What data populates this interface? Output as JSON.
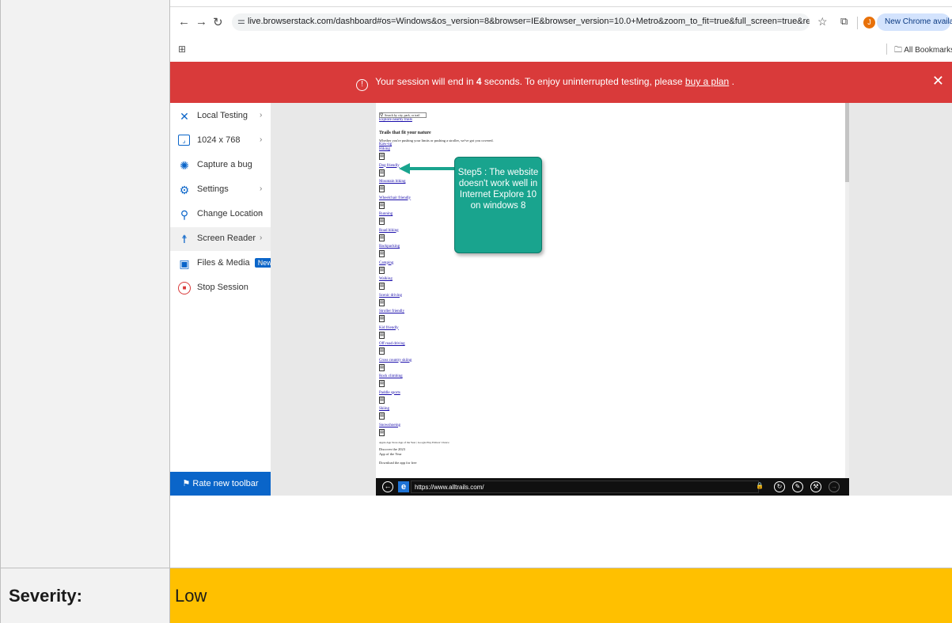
{
  "browser": {
    "url": "live.browserstack.com/dashboard#os=Windows&os_version=8&browser=IE&browser_version=10.0+Metro&zoom_to_fit=true&full_screen=true&resolution=2048x1536&...",
    "profile_initial": "J",
    "update_label": "New Chrome available",
    "all_bookmarks": "All Bookmarks"
  },
  "banner": {
    "text_before": "Your session will end in",
    "seconds": "4",
    "text_middle": "seconds. To enjoy uninterrupted testing, please",
    "link": "buy a plan",
    "text_after": "."
  },
  "sidebar": {
    "items": [
      {
        "label": "Local Testing",
        "icon": "local-testing-icon",
        "glyph": "✕",
        "chevron": true
      },
      {
        "label": "1024 x 768",
        "icon": "resolution-icon",
        "glyph": "⌜",
        "chevron": true
      },
      {
        "label": "Capture a bug",
        "icon": "bug-icon",
        "glyph": "✺",
        "chevron": false
      },
      {
        "label": "Settings",
        "icon": "gear-icon",
        "glyph": "⚙",
        "chevron": true
      },
      {
        "label": "Change Location",
        "icon": "location-pin-icon",
        "glyph": "⚲",
        "chevron": true
      },
      {
        "label": "Screen Reader",
        "icon": "accessibility-icon",
        "glyph": "☨",
        "chevron": true
      },
      {
        "label": "Files & Media",
        "icon": "media-icon",
        "glyph": "▣",
        "chevron": true,
        "badge": "New"
      },
      {
        "label": "Stop Session",
        "icon": "stop-icon",
        "glyph": "■",
        "chevron": false
      }
    ],
    "rate_button": "Rate new toolbar"
  },
  "remote": {
    "search_placeholder": "Search by city, park, or trail",
    "explore_link": "Explore nearby trails",
    "heading": "Trails that fit your nature",
    "intro": "Whether you're pushing your limits or pushing a stroller, we've got you covered.",
    "categories": [
      "Hiking",
      "Dog friendly",
      "Mountain biking",
      "Wheelchair friendly",
      "Running",
      "Road biking",
      "Backpacking",
      "Camping",
      "Walking",
      "Scenic driving",
      "Stroller friendly",
      "Kid friendly",
      "Off road driving",
      "Cross country skiing",
      "Rock climbing",
      "Paddle sports",
      "Skiing",
      "Snowshoeing"
    ],
    "first_link": "Kaw-ng",
    "badges": [
      "Apple App Store App of the Year",
      "Google Play Editors' Choice"
    ],
    "discover": "Discover the 2023",
    "app_of_year": "App of the Year",
    "download": "Download the app for free",
    "ie_url": "https://www.alltrails.com/"
  },
  "callout": {
    "text": "Step5 : The website doesn't work well in Internet Explore 10 on windows 8"
  },
  "severity": {
    "label": "Severity:",
    "value": "Low"
  },
  "colors": {
    "banner": "#d93a3a",
    "accent": "#0a65c9",
    "callout": "#19a48e",
    "severity": "#ffc000"
  }
}
